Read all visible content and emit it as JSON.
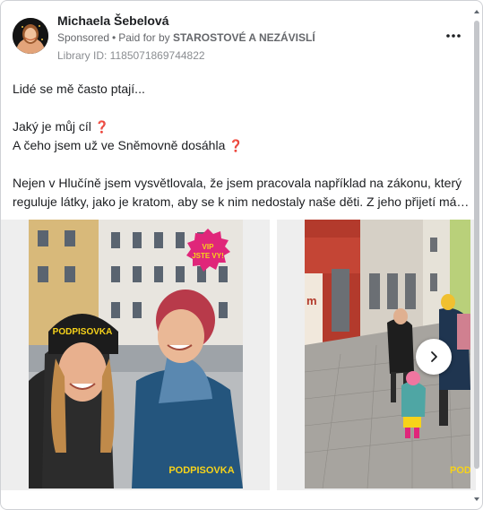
{
  "post": {
    "author": "Michaela Šebelová",
    "sponsored_label": "Sponsored",
    "separator": "•",
    "paid_for_prefix": "Paid for by",
    "payer": "STAROSTOVÉ A NEZÁVISLÍ",
    "library_id": "Library ID: 1185071869744822",
    "more_icon": "ellipsis-icon",
    "more_label": "•••"
  },
  "body": {
    "line1": "Lidé se mě často ptají...",
    "line2": "Jaký je můj cíl",
    "line3": "A čeho jsem už ve Sněmovně dosáhla",
    "question_mark": "❓",
    "line4": "Nejen v Hlučíně jsem vysvětlovala, že jsem pracovala například na zákonu, který",
    "line5": "reguluje látky, jako je kratom, aby se k nim nedostaly naše děti. Z jeho přijetí mám…"
  },
  "carousel": {
    "slide1": {
      "sticker": "VIP JSTE VY!",
      "sticker_line1": "VIP",
      "sticker_line2": "JSTE VY!",
      "hat_text": "PODPISOVKA",
      "watermark": "PODPISOVKA"
    },
    "slide2": {
      "storefront": "m",
      "watermark": "POD"
    },
    "next_icon": "chevron-right-icon"
  },
  "colors": {
    "text_primary": "#1c1e21",
    "text_secondary": "#65676b",
    "accent_pink": "#e0267a",
    "accent_yellow": "#f7d31a"
  }
}
